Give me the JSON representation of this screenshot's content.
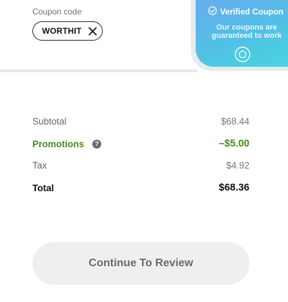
{
  "coupon": {
    "label": "Coupon code",
    "code": "WORTHIT",
    "remove_icon": "close-icon"
  },
  "verified": {
    "title": "Verified Coupon",
    "description": "Our coupons are guaranteed to work",
    "check_icon": "check-circle-icon",
    "badge_icon": "shield-badge-icon",
    "gradient_start": "#6aa9f0",
    "gradient_end": "#47d7dc"
  },
  "summary": {
    "subtotal_label": "Subtotal",
    "subtotal_value": "$68.44",
    "promotions_label": "Promotions",
    "promotions_help_icon": "question-circle-icon",
    "promotions_value": "–$5.00",
    "tax_label": "Tax",
    "tax_value": "$4.92",
    "total_label": "Total",
    "total_value": "$68.36",
    "promo_color": "#4a8a1d"
  },
  "actions": {
    "continue_label": "Continue To Review"
  }
}
